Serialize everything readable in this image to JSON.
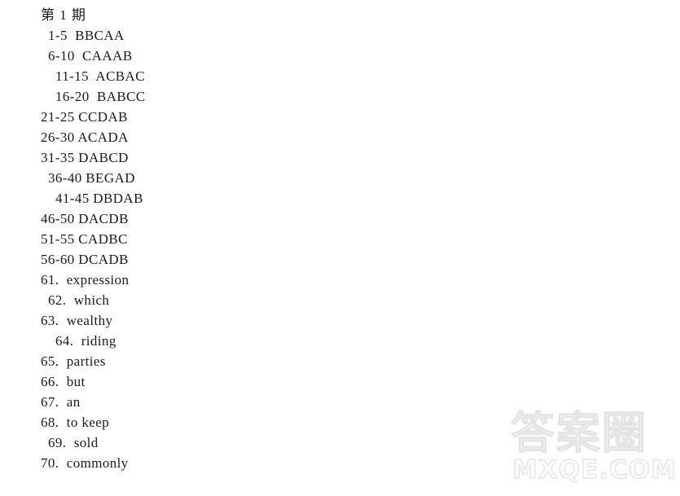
{
  "document": {
    "title": "第 1 期",
    "background_color": "#ffffff",
    "text_color": "#1b1b1b"
  },
  "answer_lines": [
    {
      "kind": "title",
      "indent": 0,
      "text": "第 1 期"
    },
    {
      "kind": "range",
      "indent": 1,
      "range": "1-5",
      "answers": "BBCAA",
      "text": "1-5  BBCAA"
    },
    {
      "kind": "range",
      "indent": 1,
      "range": "6-10",
      "answers": "CAAAB",
      "text": "6-10  CAAAB"
    },
    {
      "kind": "range",
      "indent": 2,
      "range": "11-15",
      "answers": "ACBAC",
      "text": "11-15  ACBAC"
    },
    {
      "kind": "range",
      "indent": 2,
      "range": "16-20",
      "answers": "BABCC",
      "text": "16-20  BABCC"
    },
    {
      "kind": "range",
      "indent": 0,
      "range": "21-25",
      "answers": "CCDAB",
      "text": "21-25 CCDAB"
    },
    {
      "kind": "range",
      "indent": 0,
      "range": "26-30",
      "answers": "ACADA",
      "text": "26-30 ACADA"
    },
    {
      "kind": "range",
      "indent": 0,
      "range": "31-35",
      "answers": "DABCD",
      "text": "31-35 DABCD"
    },
    {
      "kind": "range",
      "indent": 1,
      "range": "36-40",
      "answers": "BEGAD",
      "text": "36-40 BEGAD"
    },
    {
      "kind": "range",
      "indent": 2,
      "range": "41-45",
      "answers": "DBDAB",
      "text": "41-45 DBDAB"
    },
    {
      "kind": "range",
      "indent": 0,
      "range": "46-50",
      "answers": "DACDB",
      "text": "46-50 DACDB"
    },
    {
      "kind": "range",
      "indent": 0,
      "range": "51-55",
      "answers": "CADBC",
      "text": "51-55 CADBC"
    },
    {
      "kind": "range",
      "indent": 0,
      "range": "56-60",
      "answers": "DCADB",
      "text": "56-60 DCADB"
    },
    {
      "kind": "word",
      "indent": 0,
      "number": "61.",
      "word": "expression",
      "text": "61.  expression"
    },
    {
      "kind": "word",
      "indent": 1,
      "number": "62.",
      "word": "which",
      "text": "62.  which"
    },
    {
      "kind": "word",
      "indent": 0,
      "number": "63.",
      "word": "wealthy",
      "text": "63.  wealthy"
    },
    {
      "kind": "word",
      "indent": 2,
      "number": "64.",
      "word": "riding",
      "text": "64.  riding"
    },
    {
      "kind": "word",
      "indent": 0,
      "number": "65.",
      "word": "parties",
      "text": "65.  parties"
    },
    {
      "kind": "word",
      "indent": 0,
      "number": "66.",
      "word": "but",
      "text": "66.  but"
    },
    {
      "kind": "word",
      "indent": 0,
      "number": "67.",
      "word": "an",
      "text": "67.  an"
    },
    {
      "kind": "word",
      "indent": 0,
      "number": "68.",
      "word": "to keep",
      "text": "68.  to keep"
    },
    {
      "kind": "word",
      "indent": 1,
      "number": "69.",
      "word": "sold",
      "text": "69.  sold"
    },
    {
      "kind": "word",
      "indent": 0,
      "number": "70.",
      "word": "commonly",
      "text": "70.  commonly"
    }
  ],
  "watermark": {
    "brand_cn": "答案圈",
    "domain": "MXQE.COM",
    "color": "#ececec"
  }
}
